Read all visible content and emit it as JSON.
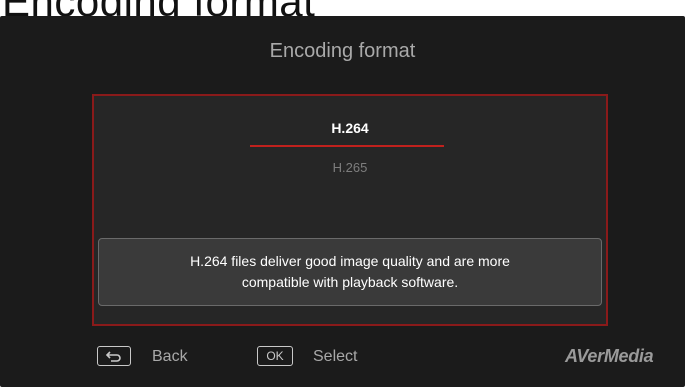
{
  "header_fragment": "Encoding format",
  "dialog": {
    "title": "Encoding format",
    "options": [
      {
        "label": "H.264",
        "selected": true
      },
      {
        "label": "H.265",
        "selected": false
      }
    ],
    "description_line1": "H.264 files deliver good image quality and are more",
    "description_line2": "compatible with playback software."
  },
  "footer": {
    "back_key_icon": "return-arrow-icon",
    "back_label": "Back",
    "ok_key": "OK",
    "select_label": "Select"
  },
  "brand": {
    "logo_text": "AVerMedia"
  },
  "colors": {
    "accent": "#c0211d",
    "panel_border": "#8a1a1a",
    "background": "#1b1b1b"
  }
}
